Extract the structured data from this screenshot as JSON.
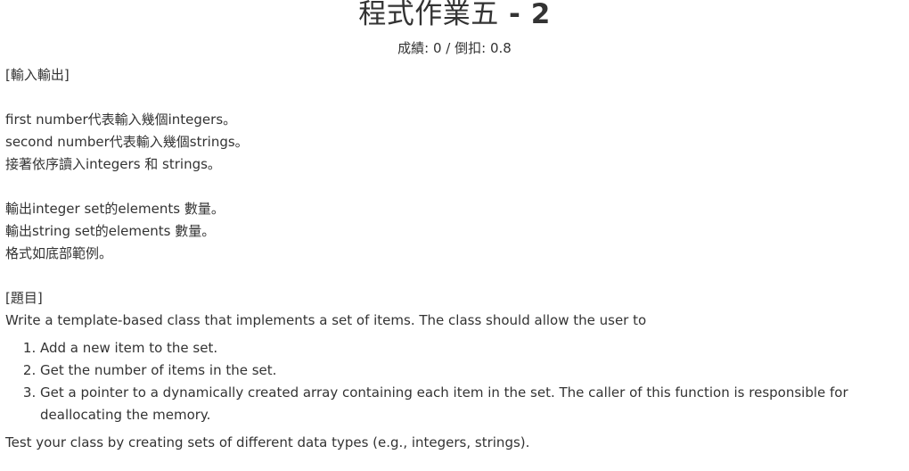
{
  "header": {
    "title_main": "程式作業五",
    "title_sep": " - ",
    "title_num": "2",
    "score_text": "成績: 0 / 倒扣: 0.8"
  },
  "io_section": {
    "heading": "[輸入輸出]",
    "lines": [
      "first number代表輸入幾個integers。",
      "second number代表輸入幾個strings。",
      "接著依序讀入integers 和 strings。"
    ],
    "output_lines": [
      "輸出integer set的elements 數量。",
      "輸出string set的elements 數量。",
      "格式如底部範例。"
    ]
  },
  "problem_section": {
    "heading": "[題目]",
    "intro": "Write a template-based class that implements a set of items. The class should allow the user to",
    "items": [
      "Add a new item to the set.",
      "Get the number of items in the set.",
      "Get a pointer to a dynamically created array containing each item in the set. The caller of this function is responsible for deallocating the memory."
    ],
    "closing": "Test your class by creating sets of different data types (e.g., integers, strings)."
  }
}
